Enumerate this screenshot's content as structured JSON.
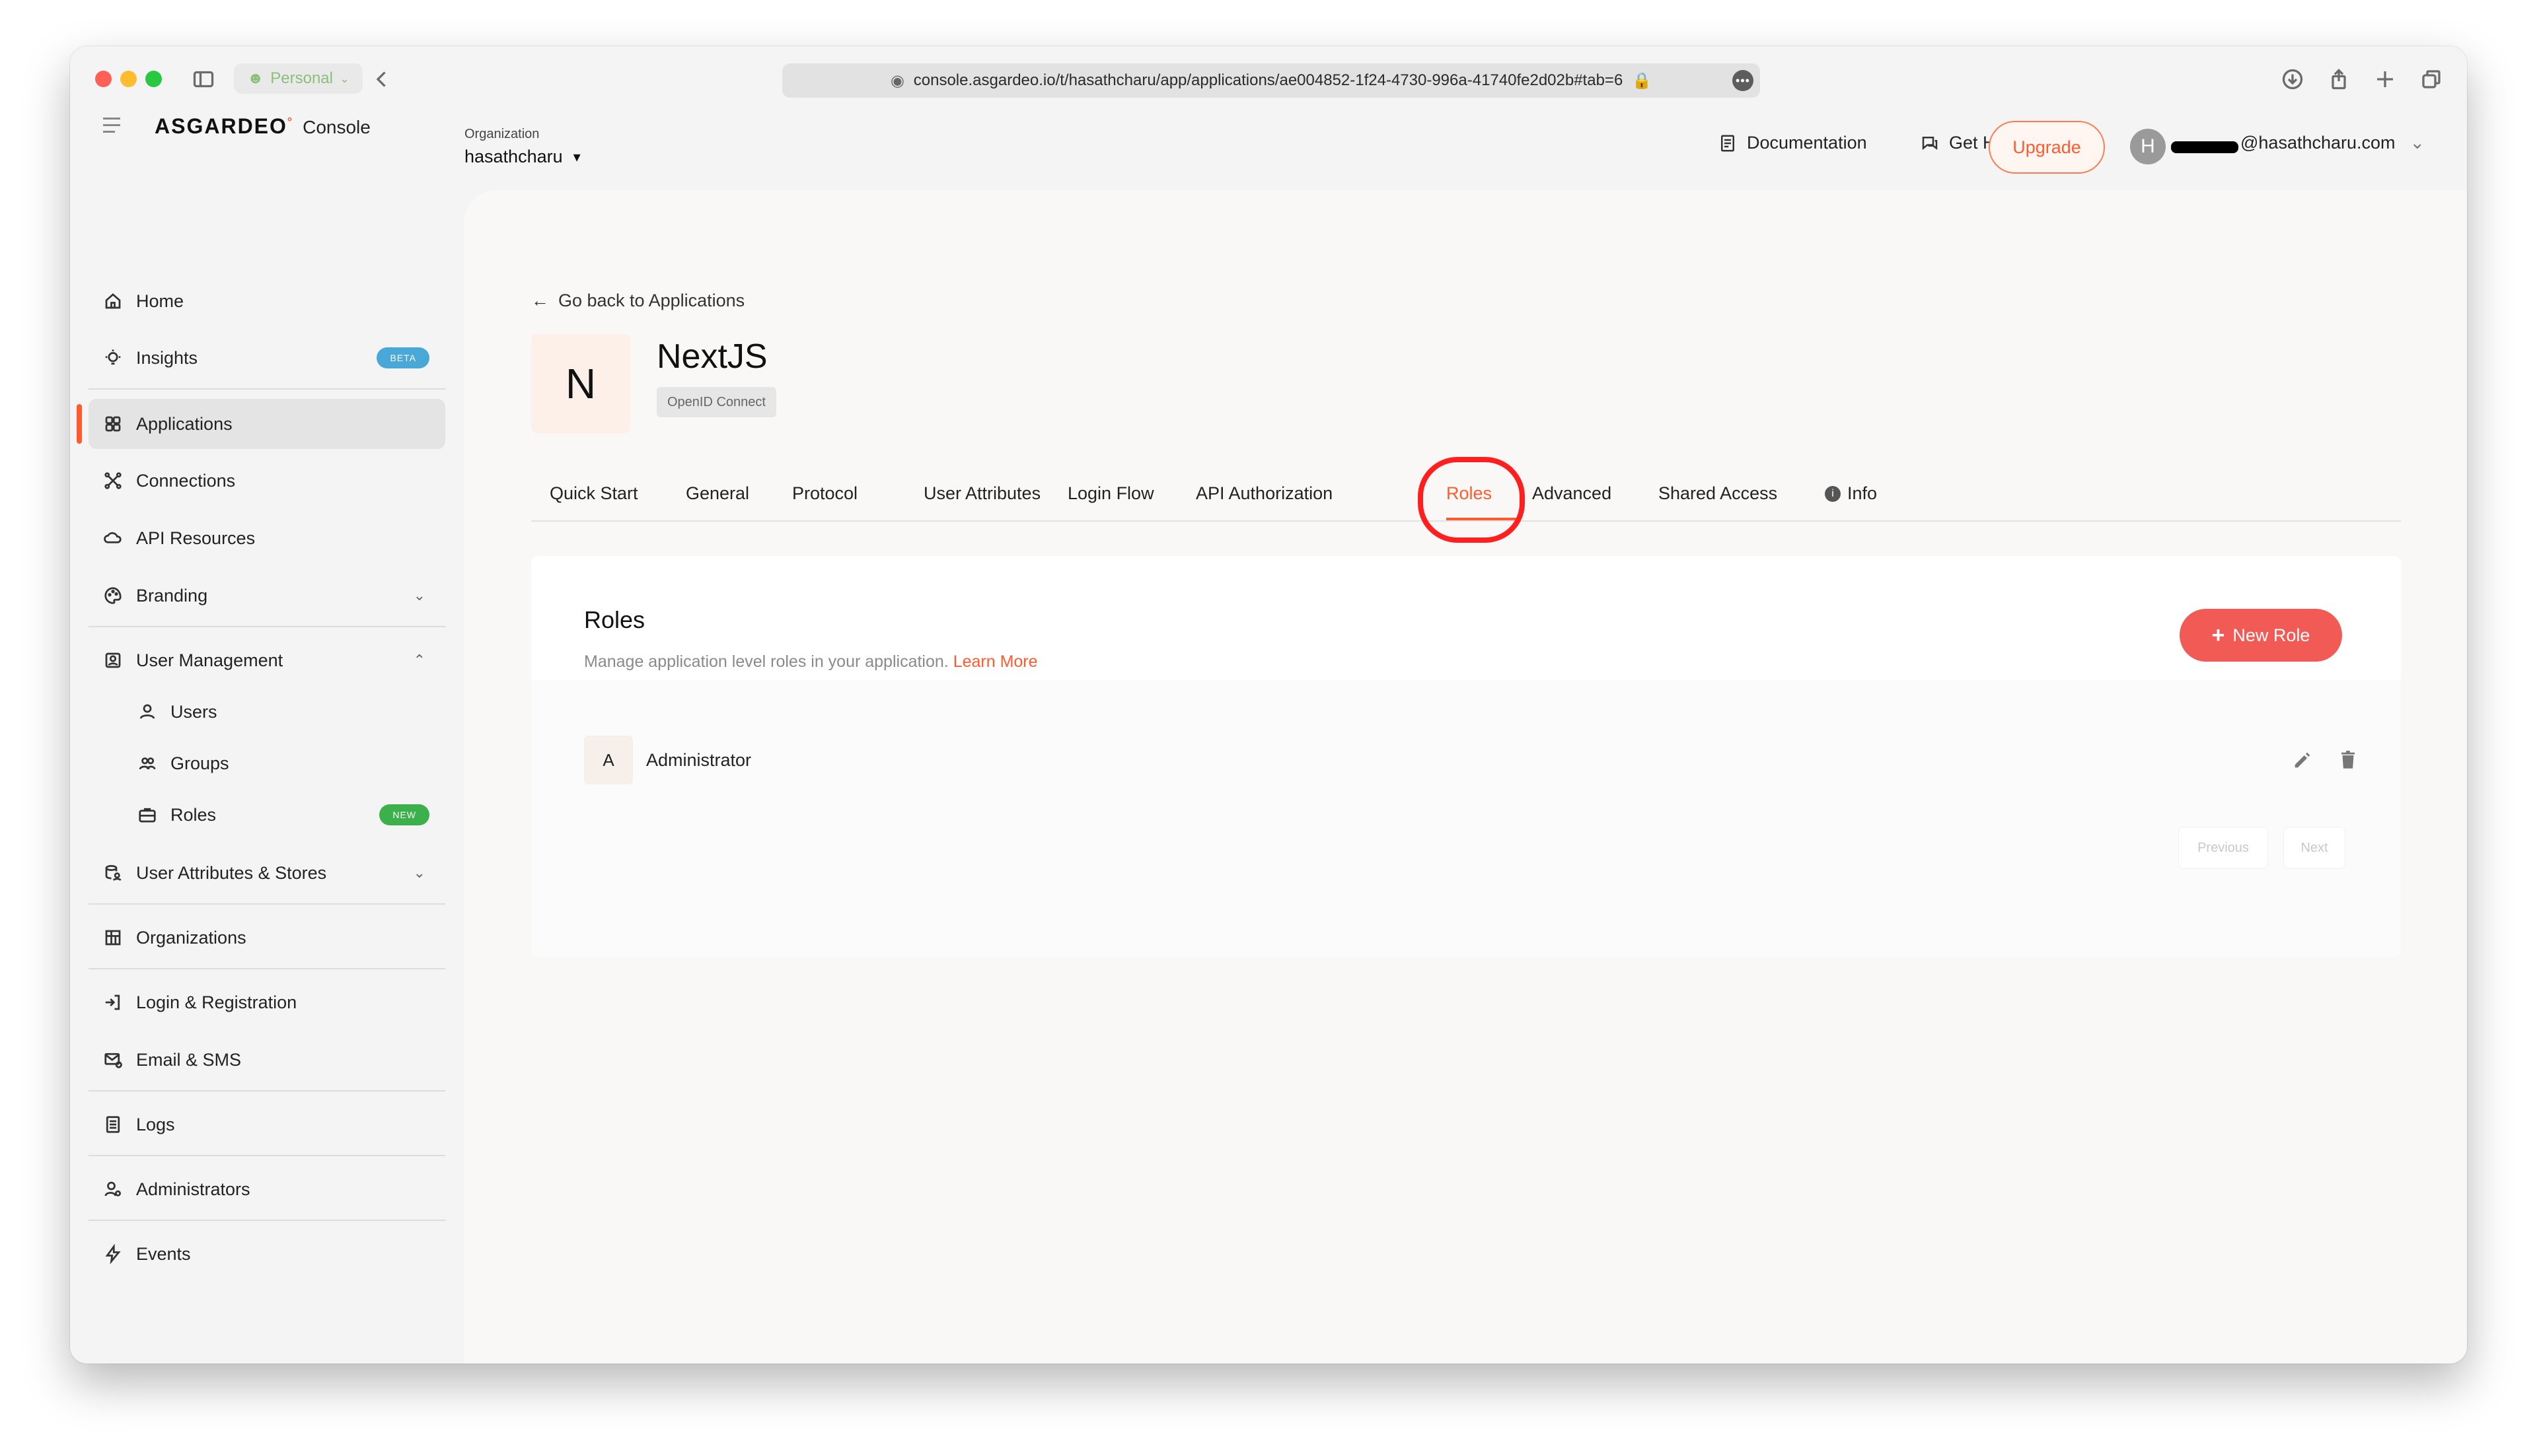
{
  "browser": {
    "profile": "Personal",
    "url": "console.asgardeo.io/t/hasathcharu/app/applications/ae004852-1f24-4730-996a-41740fe2d02b#tab=6",
    "url_more": "•••"
  },
  "header": {
    "brand": "ASGARDEO",
    "brand_mark": "°",
    "product": "Console",
    "org_label": "Organization",
    "org_name": "hasathcharu",
    "documentation": "Documentation",
    "get_help": "Get Help",
    "upgrade": "Upgrade",
    "avatar_initial": "H",
    "user_email": "@hasathcharu.com"
  },
  "sidebar": {
    "home": "Home",
    "insights": "Insights",
    "insights_badge": "BETA",
    "applications": "Applications",
    "connections": "Connections",
    "api_resources": "API Resources",
    "branding": "Branding",
    "user_management": "User Management",
    "users": "Users",
    "groups": "Groups",
    "roles": "Roles",
    "roles_badge": "NEW",
    "user_attributes_stores": "User Attributes & Stores",
    "organizations": "Organizations",
    "login_registration": "Login & Registration",
    "email_sms": "Email & SMS",
    "logs": "Logs",
    "administrators": "Administrators",
    "events": "Events"
  },
  "main": {
    "back_link": "Go back to Applications",
    "app_initial": "N",
    "app_name": "NextJS",
    "app_protocol": "OpenID Connect",
    "tabs": [
      "Quick Start",
      "General",
      "Protocol",
      "User Attributes",
      "Login Flow",
      "API Authorization",
      "Roles",
      "Advanced",
      "Shared Access",
      "Info"
    ],
    "active_tab": "Roles",
    "panel": {
      "title": "Roles",
      "description": "Manage application level roles in your application.",
      "learn_more": "Learn More",
      "new_role": "New Role",
      "roles": [
        {
          "initial": "A",
          "name": "Administrator"
        }
      ],
      "previous": "Previous",
      "next": "Next"
    }
  },
  "colors": {
    "accent": "#ff5b2e",
    "new_role_button": "#f25b55",
    "highlight": "#ff1f1f",
    "beta_badge": "#4aa8d8",
    "new_badge": "#3cb04a"
  }
}
